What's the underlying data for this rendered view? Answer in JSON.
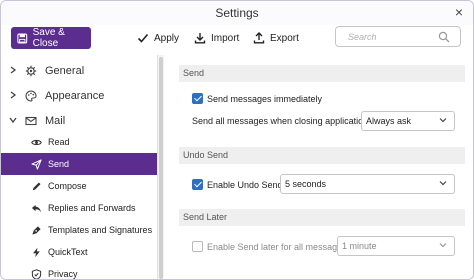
{
  "window": {
    "title": "Settings",
    "close_glyph": "×"
  },
  "toolbar": {
    "save_close_label": "Save & Close",
    "apply_label": "Apply",
    "import_label": "Import",
    "export_label": "Export",
    "search_placeholder": "Search",
    "accent": "#5b2d8e"
  },
  "sidebar": {
    "categories": [
      {
        "label": "General",
        "icon": "gear-icon",
        "expanded": false
      },
      {
        "label": "Appearance",
        "icon": "palette-icon",
        "expanded": false
      },
      {
        "label": "Mail",
        "icon": "envelope-icon",
        "expanded": true
      }
    ],
    "mail_items": [
      {
        "label": "Read",
        "icon": "eye-icon",
        "active": false
      },
      {
        "label": "Send",
        "icon": "send-icon",
        "active": true
      },
      {
        "label": "Compose",
        "icon": "pencil-icon",
        "active": false
      },
      {
        "label": "Replies and Forwards",
        "icon": "reply-icon",
        "active": false
      },
      {
        "label": "Templates and Signatures",
        "icon": "pen-nib-icon",
        "active": false
      },
      {
        "label": "QuickText",
        "icon": "bolt-icon",
        "active": false
      },
      {
        "label": "Privacy",
        "icon": "shield-icon",
        "active": false
      }
    ]
  },
  "main": {
    "send": {
      "header": "Send",
      "send_immediately_label": "Send messages immediately",
      "send_immediately_checked": true,
      "closing_label": "Send all messages when closing application:",
      "closing_value": "Always ask"
    },
    "undo_send": {
      "header": "Undo Send",
      "enable_label": "Enable Undo Send:",
      "enable_checked": true,
      "delay_value": "5 seconds"
    },
    "send_later": {
      "header": "Send Later",
      "enable_label": "Enable Send later for all messages:",
      "enable_checked": false,
      "delay_value": "1 minute"
    }
  }
}
